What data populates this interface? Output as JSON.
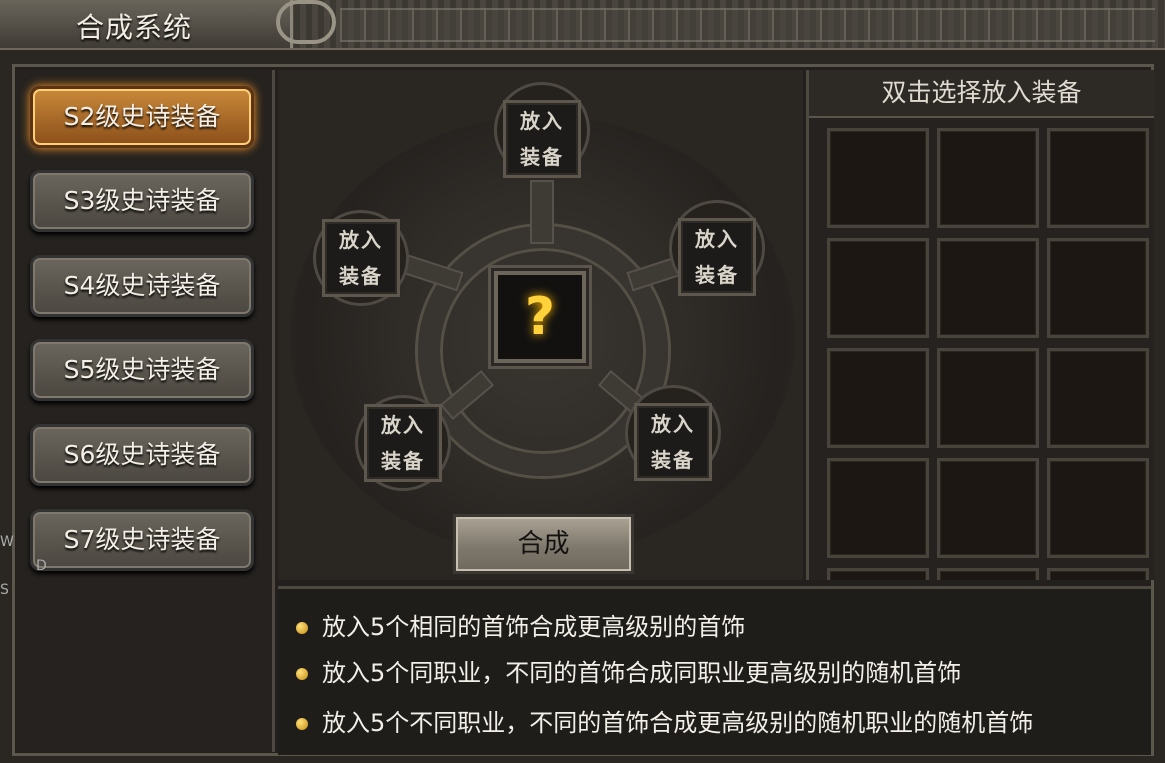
{
  "window": {
    "title": "合成系统"
  },
  "menu": {
    "items": [
      {
        "label": "S2级史诗装备",
        "active": true
      },
      {
        "label": "S3级史诗装备",
        "active": false
      },
      {
        "label": "S4级史诗装备",
        "active": false
      },
      {
        "label": "S5级史诗装备",
        "active": false
      },
      {
        "label": "S6级史诗装备",
        "active": false
      },
      {
        "label": "S7级史诗装备",
        "active": false
      }
    ]
  },
  "craft": {
    "slots": [
      {
        "line1": "放入",
        "line2": "装备"
      },
      {
        "line1": "放入",
        "line2": "装备"
      },
      {
        "line1": "放入",
        "line2": "装备"
      },
      {
        "line1": "放入",
        "line2": "装备"
      },
      {
        "line1": "放入",
        "line2": "装备"
      }
    ],
    "result_symbol": "?",
    "button_label": "合成"
  },
  "inventory": {
    "header": "双击选择放入装备",
    "cells": 15
  },
  "description": {
    "lines": [
      "放入5个相同的首饰合成更高级别的首饰",
      "放入5个同职业，不同的首饰合成同职业更高级别的随机首饰",
      "放入5个不同职业，不同的首饰合成更高级别的随机职业的随机首饰"
    ]
  },
  "edge_text": {
    "a": "W",
    "b": "D",
    "c": "S"
  },
  "colors": {
    "accent": "#ffb800",
    "active_button": "#c9893a",
    "text": "#f2efe8"
  }
}
